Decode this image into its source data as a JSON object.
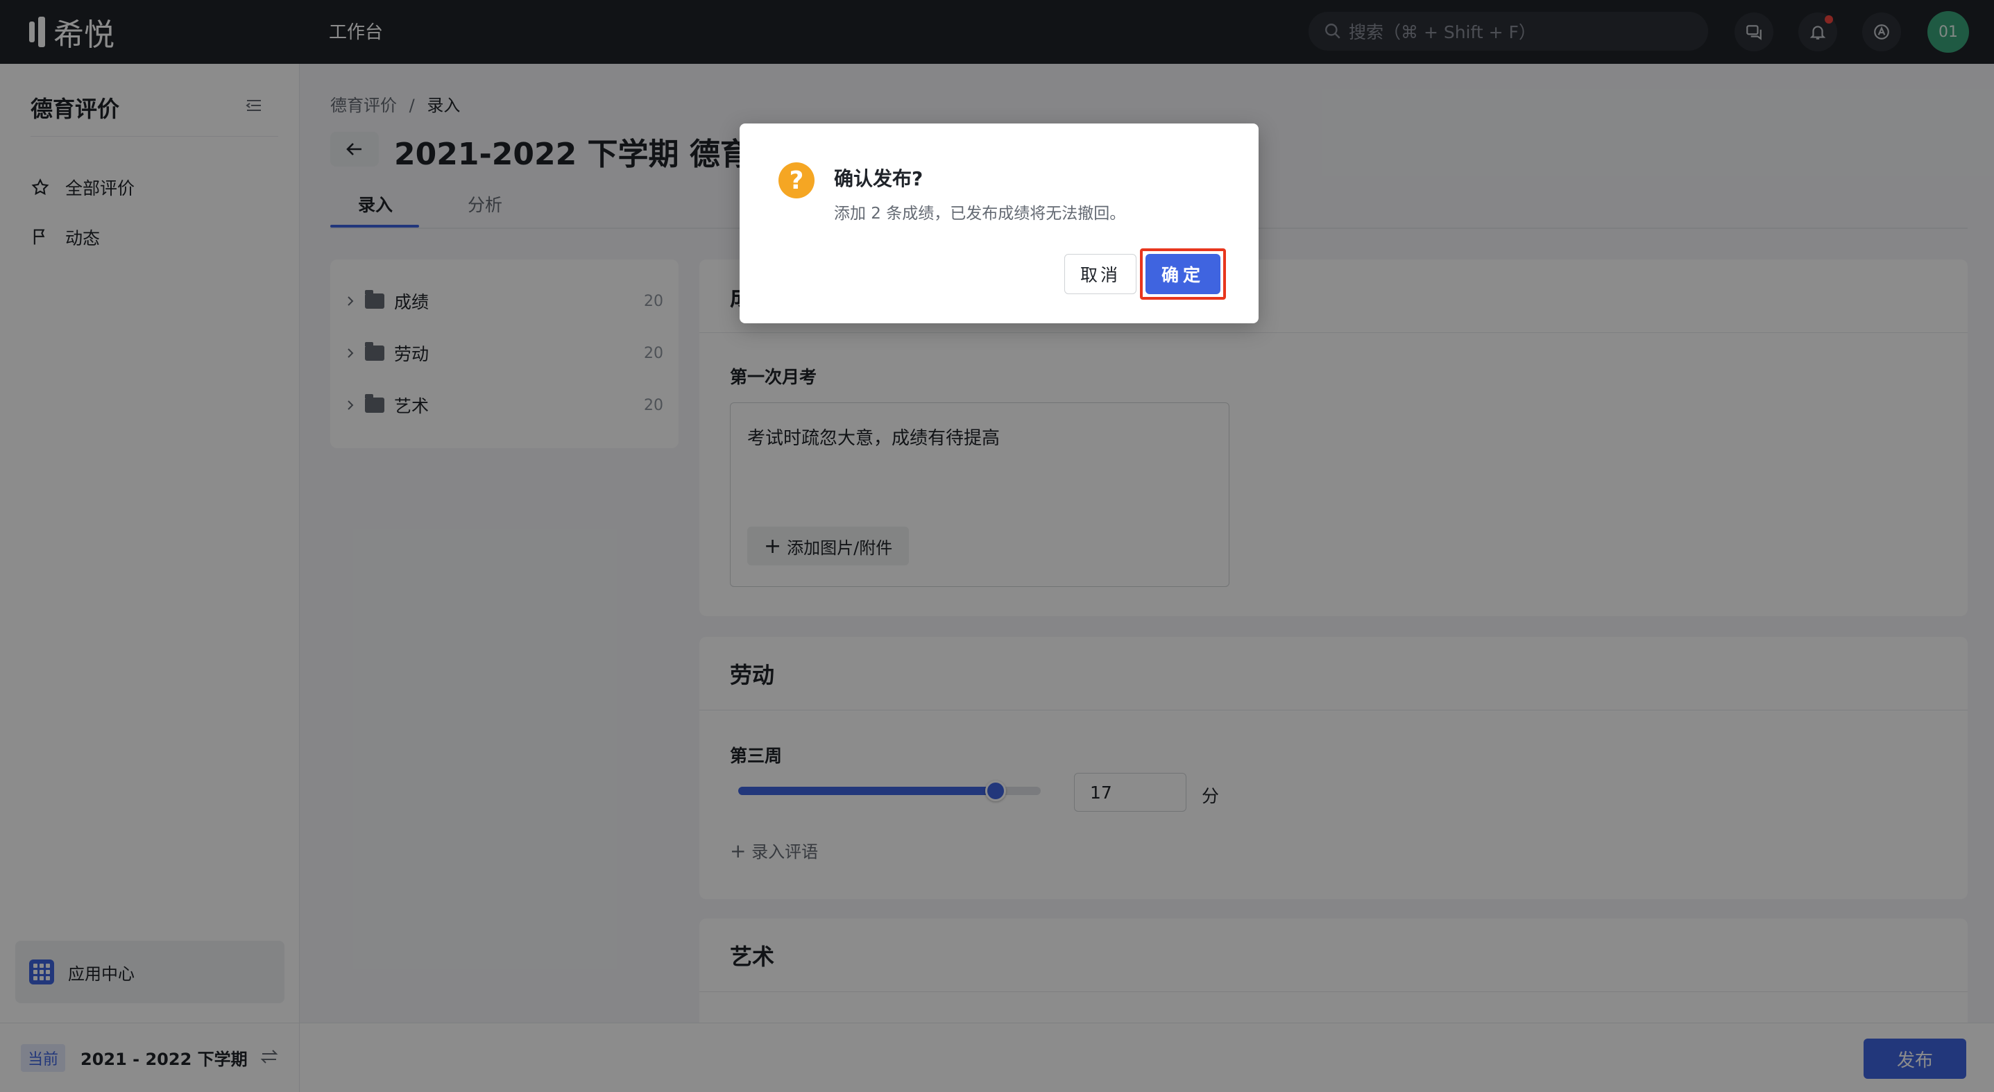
{
  "topbar": {
    "logo_text": "希悦",
    "workbench": "工作台",
    "search_placeholder": "搜索（⌘ + Shift + F）",
    "avatar_text": "01"
  },
  "sidebar": {
    "title": "德育评价",
    "items": [
      {
        "label": "全部评价",
        "icon": "star-icon"
      },
      {
        "label": "动态",
        "icon": "flag-icon"
      }
    ],
    "app_center": "应用中心",
    "current_badge": "当前",
    "term": "2021 - 2022 下学期"
  },
  "main": {
    "breadcrumb": {
      "root": "德育评价",
      "separator": "/",
      "current": "录入"
    },
    "title": "2021-2022 下学期 德育评价",
    "tabs": [
      {
        "label": "录入"
      },
      {
        "label": "分析"
      }
    ],
    "tree": [
      {
        "label": "成绩",
        "count": "20"
      },
      {
        "label": "劳动",
        "count": "20"
      },
      {
        "label": "艺术",
        "count": "20"
      }
    ],
    "cards": {
      "score": {
        "title": "成绩",
        "sub": "第一次月考",
        "comment": "考试时疏忽大意，成绩有待提高",
        "attach_label": "添加图片/附件"
      },
      "labor": {
        "title": "劳动",
        "sub": "第三周",
        "value": "17",
        "max_value": 20,
        "unit": "分",
        "add_comment": "录入评语"
      },
      "art": {
        "title": "艺术"
      }
    },
    "publish_label": "发布"
  },
  "modal": {
    "title": "确认发布?",
    "description": "添加 2 条成绩，已发布成绩将无法撤回。",
    "cancel_label": "取消",
    "confirm_label": "确定"
  },
  "colors": {
    "accent": "#3f64e0",
    "topbar": "#1f2329",
    "warning": "#f5a623",
    "highlight": "#e8361d"
  }
}
